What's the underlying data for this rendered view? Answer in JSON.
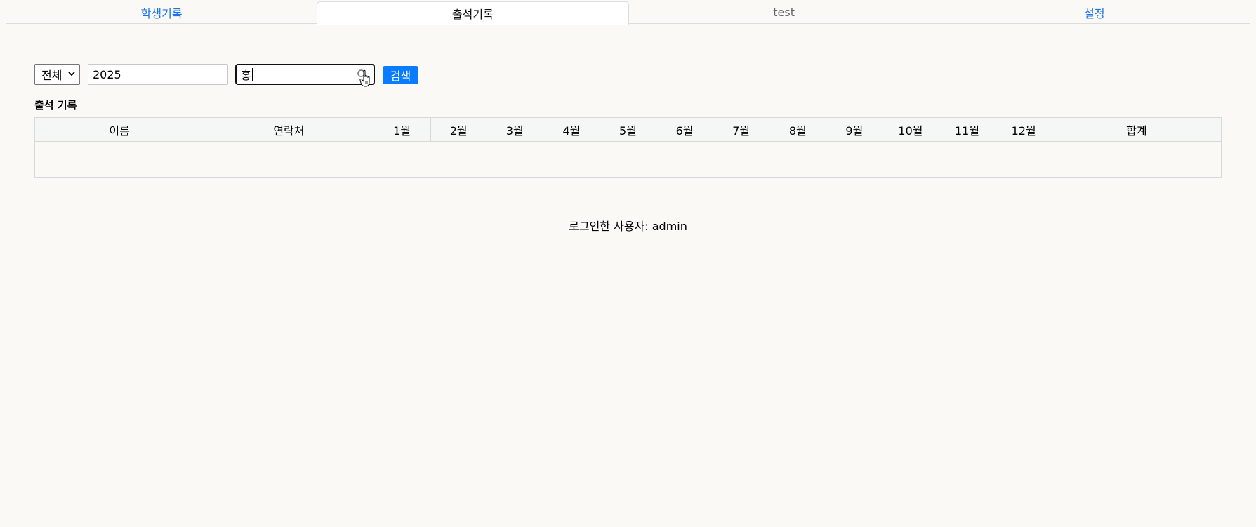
{
  "tabs": [
    {
      "label": "학생기록",
      "active": false
    },
    {
      "label": "출석기록",
      "active": true
    },
    {
      "label": "test",
      "active": false
    },
    {
      "label": "설정",
      "active": false
    }
  ],
  "filters": {
    "category_selected": "전체",
    "year_value": "2025",
    "name_value": "홍",
    "search_label": "검색"
  },
  "section": {
    "title": "출석 기록"
  },
  "table": {
    "headers": [
      "이름",
      "연락처",
      "1월",
      "2월",
      "3월",
      "4월",
      "5월",
      "6월",
      "7월",
      "8월",
      "9월",
      "10월",
      "11월",
      "12월",
      "합계"
    ],
    "rows": []
  },
  "footer": {
    "text": "로그인한 사용자: admin"
  },
  "colors": {
    "link": "#1a73e8",
    "button": "#0a7cff",
    "background": "#faf9f6"
  }
}
